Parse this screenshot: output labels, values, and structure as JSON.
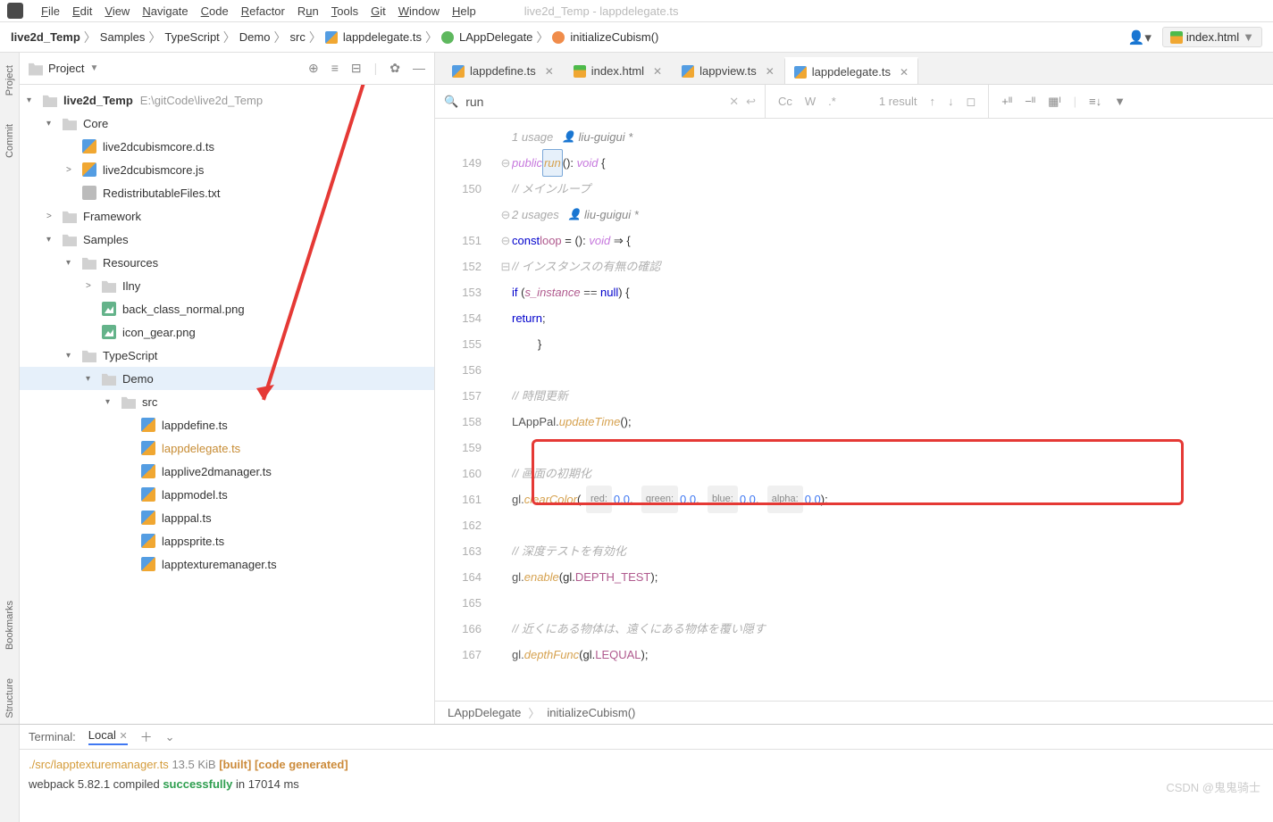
{
  "menu": {
    "items": [
      "File",
      "Edit",
      "View",
      "Navigate",
      "Code",
      "Refactor",
      "Run",
      "Tools",
      "Git",
      "Window",
      "Help"
    ],
    "title": "live2d_Temp - lappdelegate.ts"
  },
  "breadcrumb": [
    "live2d_Temp",
    "Samples",
    "TypeScript",
    "Demo",
    "src",
    "lappdelegate.ts",
    "LAppDelegate",
    "initializeCubism()"
  ],
  "config": "index.html",
  "project": {
    "label": "Project",
    "root": {
      "name": "live2d_Temp",
      "path": "E:\\gitCode\\live2d_Temp"
    },
    "tree": [
      {
        "d": 1,
        "t": "dir",
        "n": "Core",
        "exp": true
      },
      {
        "d": 2,
        "t": "ts",
        "n": "live2dcubismcore.d.ts"
      },
      {
        "d": 2,
        "t": "js",
        "n": "live2dcubismcore.js",
        "chev": ">"
      },
      {
        "d": 2,
        "t": "txt",
        "n": "RedistributableFiles.txt"
      },
      {
        "d": 1,
        "t": "dir",
        "n": "Framework",
        "chev": ">"
      },
      {
        "d": 1,
        "t": "dir",
        "n": "Samples",
        "exp": true
      },
      {
        "d": 2,
        "t": "dir",
        "n": "Resources",
        "exp": true
      },
      {
        "d": 3,
        "t": "dir",
        "n": "Ilny",
        "chev": ">"
      },
      {
        "d": 3,
        "t": "png",
        "n": "back_class_normal.png"
      },
      {
        "d": 3,
        "t": "png",
        "n": "icon_gear.png"
      },
      {
        "d": 2,
        "t": "dir",
        "n": "TypeScript",
        "exp": true
      },
      {
        "d": 3,
        "t": "dir",
        "n": "Demo",
        "exp": true,
        "sel": true
      },
      {
        "d": 4,
        "t": "dir",
        "n": "src",
        "exp": true
      },
      {
        "d": 5,
        "t": "ts",
        "n": "lappdefine.ts"
      },
      {
        "d": 5,
        "t": "ts",
        "n": "lappdelegate.ts",
        "active": true
      },
      {
        "d": 5,
        "t": "ts",
        "n": "lapplive2dmanager.ts"
      },
      {
        "d": 5,
        "t": "ts",
        "n": "lappmodel.ts"
      },
      {
        "d": 5,
        "t": "ts",
        "n": "lapppal.ts"
      },
      {
        "d": 5,
        "t": "ts",
        "n": "lappsprite.ts"
      },
      {
        "d": 5,
        "t": "ts",
        "n": "lapptexturemanager.ts"
      }
    ]
  },
  "tabs": [
    {
      "n": "lappdefine.ts",
      "t": "ts"
    },
    {
      "n": "index.html",
      "t": "html"
    },
    {
      "n": "lappview.ts",
      "t": "ts"
    },
    {
      "n": "lappdelegate.ts",
      "t": "ts",
      "active": true
    }
  ],
  "find": {
    "q": "run",
    "results": "1 result"
  },
  "code": {
    "start": 149,
    "hint1": {
      "usages": "1 usage",
      "author": "liu-guigui *"
    },
    "hint2": {
      "usages": "2 usages",
      "author": "liu-guigui *"
    },
    "lines": {
      "run_kw": "public",
      "run_name": "run",
      "void": "void",
      "c_mainloop": "// メインループ",
      "const": "const",
      "loop": "loop",
      "arrow": "= (): ",
      "arrow2": " ⇒ {",
      "c_inst": "// インスタンスの有無の確認",
      "if": "if",
      "s_inst": "s_instance",
      "eqnull": " == ",
      "null": "null",
      "return": "return",
      "c_time": "// 時間更新",
      "lapppal": "LAppPal",
      "updateTime": "updateTime",
      "c_screen": "// 画面の初期化",
      "gl": "gl",
      "clearColor": "clearColor",
      "p_red": "red:",
      "p_green": "green:",
      "p_blue": "blue:",
      "p_alpha": "alpha:",
      "zero": "0.0",
      "c_depth": "// 深度テストを有効化",
      "enable": "enable",
      "DEPTH_TEST": "DEPTH_TEST",
      "c_near": "// 近くにある物体は、遠くにある物体を覆い隠す",
      "depthFunc": "depthFunc",
      "LEQUAL": "LEQUAL"
    }
  },
  "ed_crumb": [
    "LAppDelegate",
    "initializeCubism()"
  ],
  "terminal": {
    "label": "Terminal:",
    "tab": "Local",
    "l1": {
      "size": "13.5 KiB",
      "built": "[built]",
      "gen": "[code generated]"
    },
    "l2": {
      "a": "webpack 5.82.1 compiled ",
      "succ": "successfully",
      "b": " in 17014 ms"
    }
  },
  "watermark": "CSDN @鬼鬼骑士"
}
